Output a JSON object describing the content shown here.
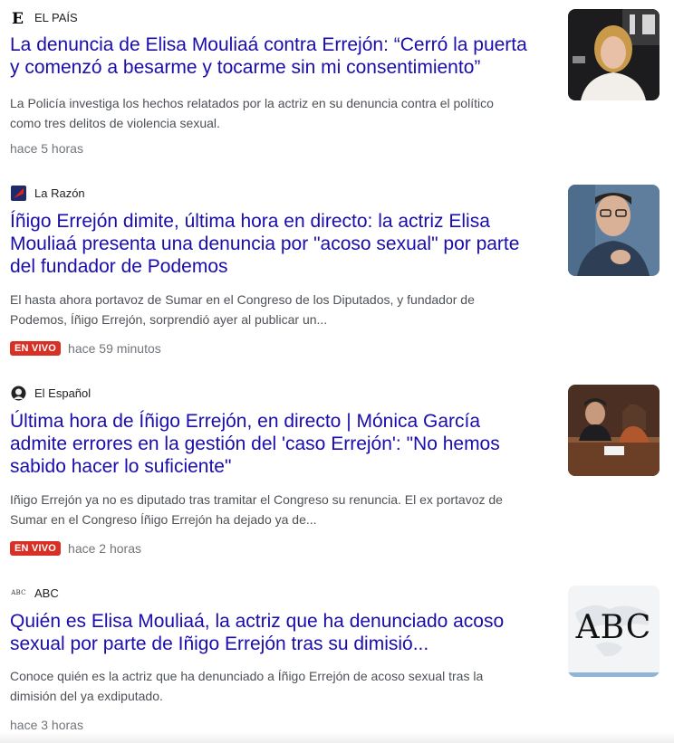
{
  "articles": [
    {
      "source": "EL PAÍS",
      "logo_icon": "el-pais-logo-icon",
      "title_line1": "La denuncia de Elisa Mouliaá contra Errejón: “Cerró la puerta",
      "title_line2": "y comenzó a besarme y tocarme sin mi consentimiento”",
      "snippet_line1": "La Policía investiga los hechos relatados por la actriz en su denuncia contra el político",
      "snippet_line2": "como tres delitos de violencia sexual.",
      "badge": "",
      "time": "hace 5 horas",
      "thumbnail_icon": "woman-portrait-thumbnail"
    },
    {
      "source": "La Razón",
      "logo_icon": "la-razon-logo-icon",
      "title_line1": "Íñigo Errejón dimite, última hora en directo: la actriz Elisa",
      "title_line2": "Mouliaá presenta una denuncia por \"acoso sexual\" por parte",
      "title_line3": "del fundador de Podemos",
      "snippet_line1": "El hasta ahora portavoz de Sumar en el Congreso de los Diputados, y fundador de",
      "snippet_line2": "Podemos, Íñigo Errejón, sorprendió ayer al publicar un...",
      "badge": "EN VIVO",
      "time": "hace 59 minutos",
      "thumbnail_icon": "man-portrait-thumbnail"
    },
    {
      "source": "El Español",
      "logo_icon": "el-espanol-logo-icon",
      "title_line1": "Última hora de Íñigo Errejón, en directo | Mónica García",
      "title_line2": "admite errores en la gestión del 'caso Errejón': \"No hemos",
      "title_line3": "sabido hacer lo suficiente\"",
      "snippet_line1": "Iñigo Errejón ya no es diputado tras tramitar el Congreso su renuncia. El ex portavoz de",
      "snippet_line2": "Sumar en el Congreso Íñigo Errejón ha dejado ya de...",
      "badge": "EN VIVO",
      "time": "hace 2 horas",
      "thumbnail_icon": "congress-thumbnail"
    },
    {
      "source": "ABC",
      "logo_icon": "abc-logo-icon",
      "logo_text": "ABC",
      "thumb_text": "ABC",
      "title_line1": "Quién es Elisa Mouliaá, la actriz que ha denunciado acoso",
      "title_line2": "sexual por parte de Iñigo Errejón tras su dimisió...",
      "snippet_line1": "Conoce quién es la actriz que ha denunciado a Íñigo Errejón de acoso sexual tras la",
      "snippet_line2": "dimisión del ya exdiputado.",
      "badge": "",
      "time": "hace 3 horas",
      "thumbnail_icon": "abc-logo-thumbnail"
    }
  ],
  "colors": {
    "headline": "#1a0dab",
    "snippet": "#4d5156",
    "meta": "#70757a",
    "live_badge": "#d93025"
  }
}
